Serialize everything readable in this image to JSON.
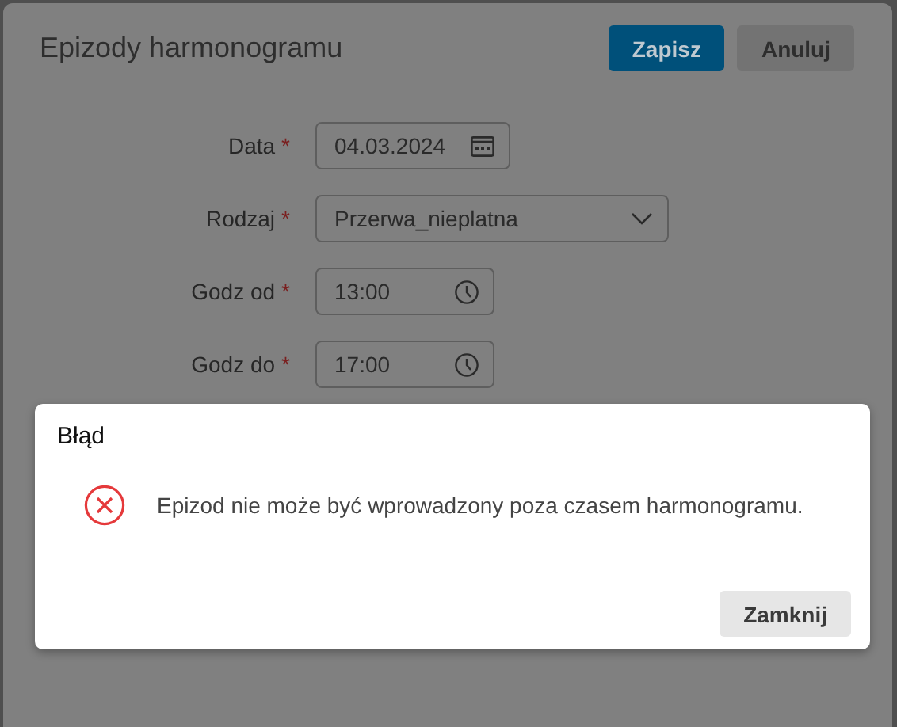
{
  "dialog": {
    "title": "Epizody harmonogramu",
    "buttons": [
      {
        "label": "Zapisz",
        "kind": "primary"
      },
      {
        "label": "Anuluj",
        "kind": "secondary"
      }
    ],
    "fields": [
      {
        "label": "Data",
        "required_mark": "*",
        "value": "04.03.2024",
        "kind": "date"
      },
      {
        "label": "Rodzaj",
        "required_mark": "*",
        "value": "Przerwa_nieplatna",
        "kind": "select"
      },
      {
        "label": "Godz od",
        "required_mark": "*",
        "value": "13:00",
        "kind": "time"
      },
      {
        "label": "Godz do",
        "required_mark": "*",
        "value": "17:00",
        "kind": "time"
      }
    ]
  },
  "error_dialog": {
    "title": "Błąd",
    "message": "Epizod nie może być wprowadzony poza czasem harmonogramu.",
    "buttons": [
      "Zamknij"
    ]
  }
}
